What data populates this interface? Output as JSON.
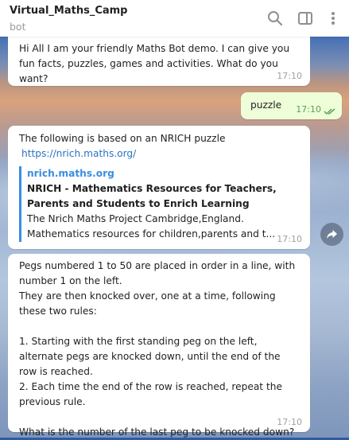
{
  "header": {
    "title": "Virtual_Maths_Camp",
    "subtitle": "bot",
    "icons": [
      "search-icon",
      "sidebar-toggle-icon",
      "more-vertical-icon"
    ]
  },
  "messages": [
    {
      "direction": "in",
      "text": "Hi All I am your friendly Maths Bot demo. I can give you fun facts, puzzles, games and activities. What do you want?",
      "time": "17:10"
    },
    {
      "direction": "out",
      "text": "puzzle",
      "time": "17:10",
      "status": "read"
    },
    {
      "direction": "in",
      "text": "The following is based on an NRICH puzzle",
      "link": "https://nrich.maths.org/",
      "preview": {
        "site": "nrich.maths.org",
        "title": "NRICH - Mathematics Resources for Teachers, Parents and Students to Enrich Learning",
        "description": "The Nrich Maths Project Cambridge,England. Mathematics resources for children,parents and t..."
      },
      "time": "17:10"
    },
    {
      "direction": "in",
      "text": "Pegs numbered 1 to 50 are placed in order in a line, with number 1 on the left.\nThey are then knocked over, one at a time, following these two rules:\n\n1. Starting with the first standing peg on the left, alternate pegs are knocked down, until the end of the row is reached.\n2. Each time the end of the row is reached, repeat the previous rule.\n\nWhat is the number of the last peg to be knocked down?",
      "time": "17:10"
    }
  ],
  "colors": {
    "header_bg": "#ffffff",
    "incoming_bg": "#ffffff",
    "outgoing_bg": "#eefed9",
    "link": "#2a73c2",
    "preview_accent": "#3a8de0",
    "read_check": "#5aa153"
  }
}
